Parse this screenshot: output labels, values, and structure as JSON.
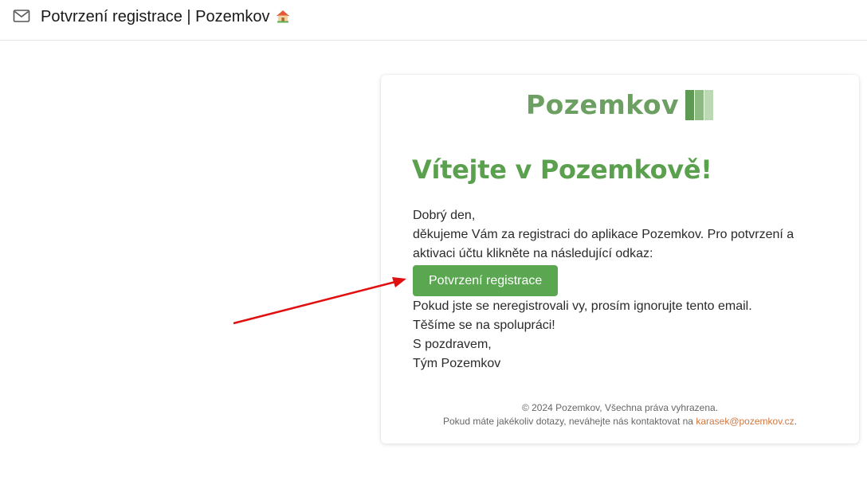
{
  "header": {
    "subject": "Potvrzení registrace | Pozemkov"
  },
  "email": {
    "logo_text": "Pozemkov",
    "heading": "Vítejte v Pozemkově!",
    "greeting": "Dobrý den,",
    "intro_line1": "děkujeme Vám za registraci do aplikace Pozemkov. Pro potvrzení a",
    "intro_line2": "aktivaci účtu klikněte na následující odkaz:",
    "button_label": "Potvrzení registrace",
    "ignore_note": "Pokud jste se neregistrovali vy, prosím ignorujte tento email.",
    "looking_forward": "Těšíme se na spolupráci!",
    "regards": "S pozdravem,",
    "signature": "Tým Pozemkov",
    "footer_copyright": "© 2024 Pozemkov, Všechna práva vyhrazena.",
    "footer_contact": "Pokud máte jakékoliv dotazy, neváhejte nás kontaktovat na",
    "footer_email": "karasek@pozemkov.cz",
    "footer_period": "."
  },
  "icons": {
    "mail": "mail-icon",
    "house": "house-icon",
    "logo_mark": "logo-bars-icon",
    "annotation": "red-arrow"
  },
  "colors": {
    "brand_green": "#5aa651",
    "logo_green": "#6c9f62",
    "link_orange": "#d2773f",
    "arrow_red": "#e01010"
  }
}
